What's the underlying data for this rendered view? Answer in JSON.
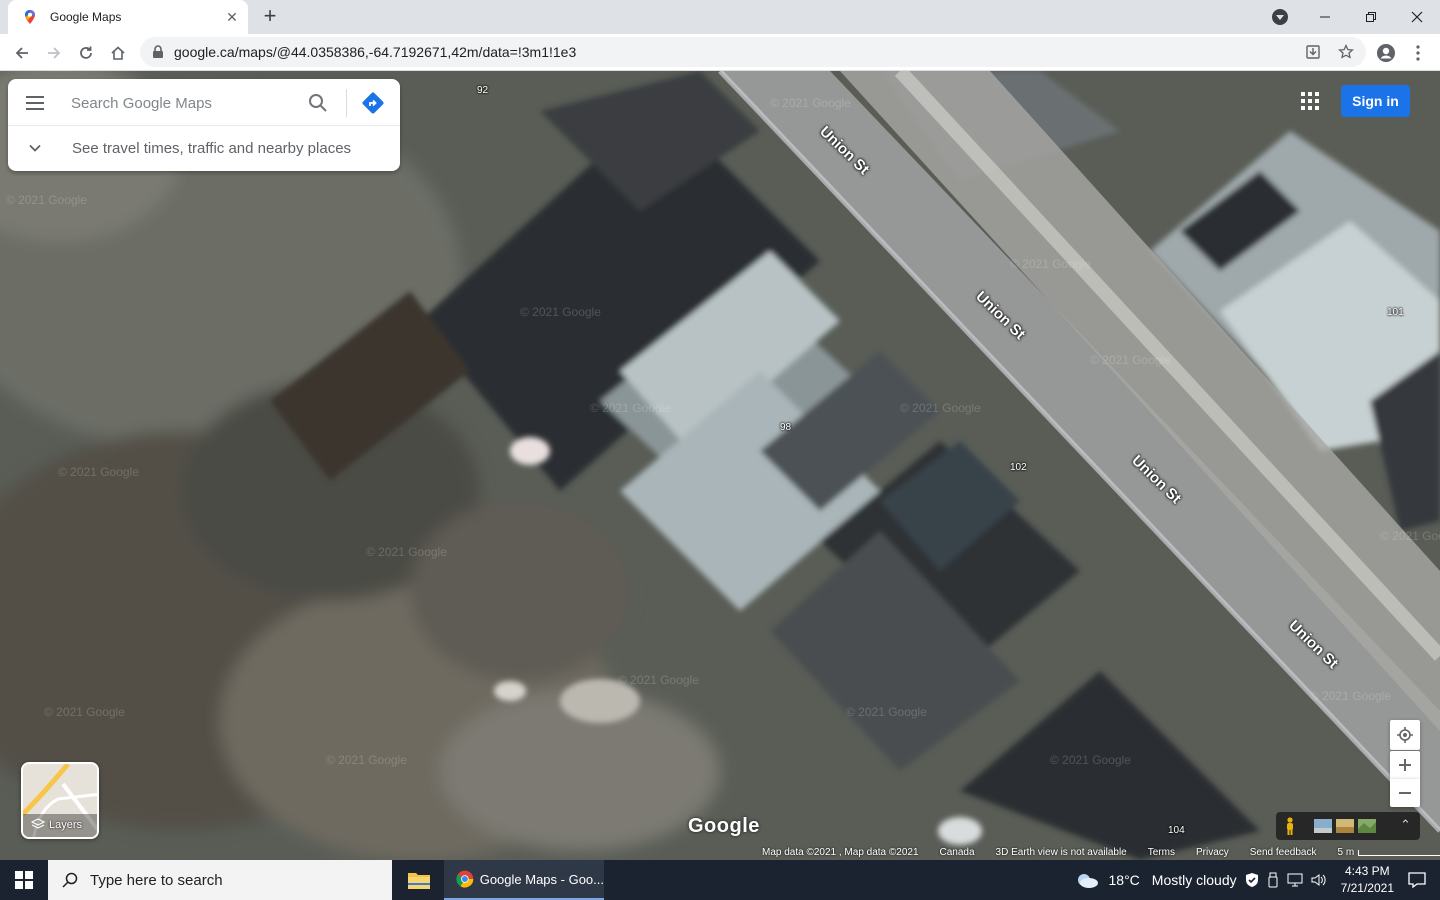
{
  "browser": {
    "tab_title": "Google Maps",
    "url": "google.ca/maps/@44.0358386,-64.7192671,42m/data=!3m1!1e3"
  },
  "map": {
    "search_placeholder": "Search Google Maps",
    "travel_text": "See travel times, traffic and nearby places",
    "sign_in": "Sign in",
    "layers_label": "Layers",
    "google_logo": "Google",
    "streets": [
      "Union St",
      "Union St",
      "Union St",
      "Union St"
    ],
    "house_numbers": [
      "92",
      "101",
      "98",
      "102",
      "104"
    ],
    "watermark": "© 2021 Google",
    "attribution": {
      "map_data": "Map data ©2021 , Map data ©2021",
      "country": "Canada",
      "earth": "3D Earth view is not available",
      "terms": "Terms",
      "privacy": "Privacy",
      "feedback": "Send feedback",
      "scale": "5 m"
    }
  },
  "taskbar": {
    "search_placeholder": "Type here to search",
    "chrome_label": "Google Maps - Goo...",
    "weather_temp": "18°C",
    "weather_desc": "Mostly cloudy",
    "time": "4:43 PM",
    "date": "7/21/2021"
  }
}
